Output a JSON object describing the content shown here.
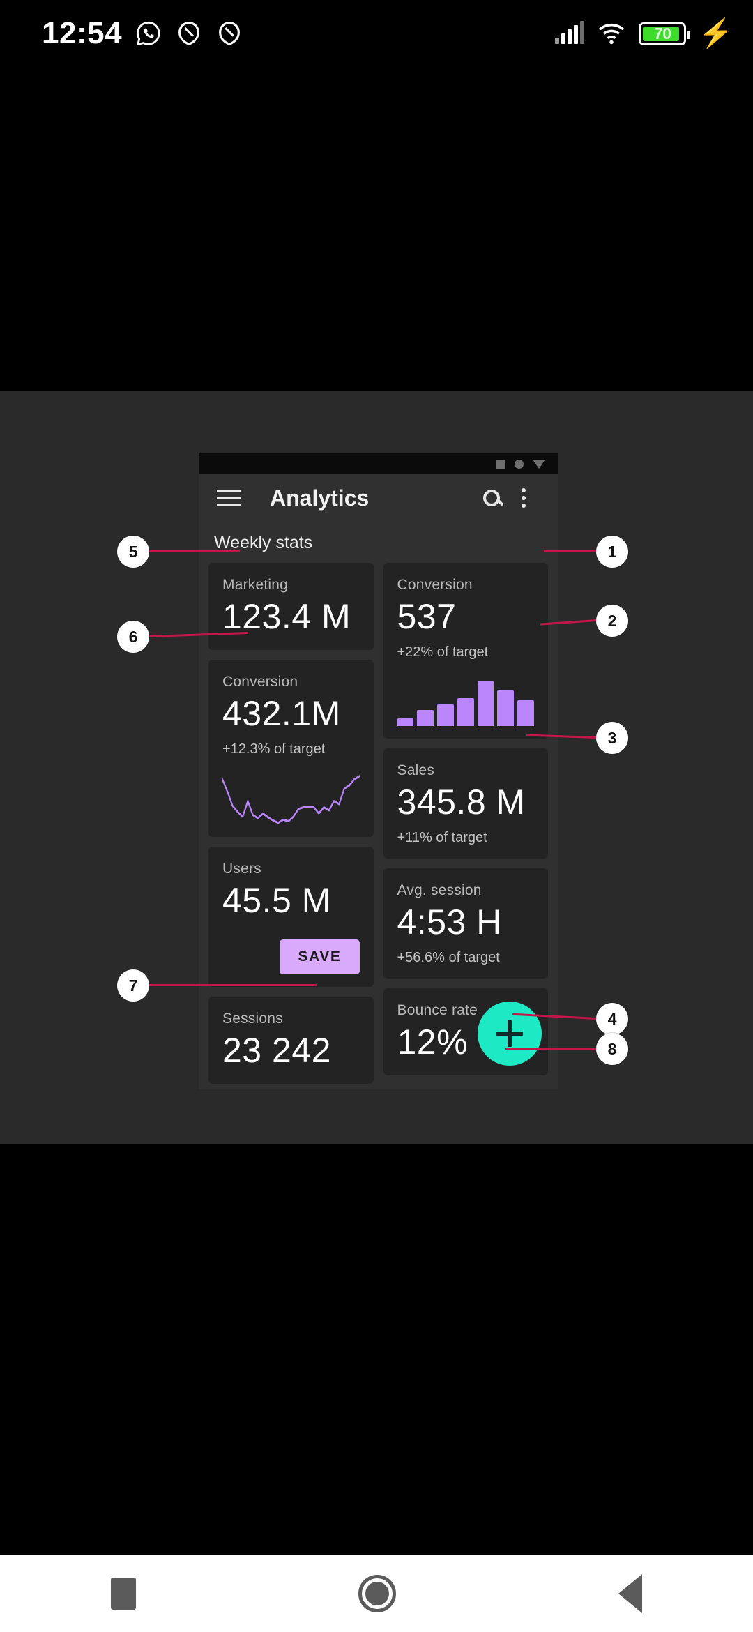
{
  "status_bar": {
    "clock": "12:54",
    "left_icons": [
      "whatsapp-icon",
      "dnd-icon",
      "dnd-icon"
    ],
    "signal_icon": "cellular-signal-icon",
    "wifi_icon": "wifi-icon",
    "battery_level": "70",
    "charging_icon": "lightning-bolt-icon"
  },
  "device_preview": {
    "mock_status_icons": [
      "square-icon",
      "circle-icon",
      "triangle-down-icon"
    ],
    "appbar": {
      "menu_icon": "hamburger-menu-icon",
      "title": "Analytics",
      "search_icon": "search-icon",
      "overflow_icon": "more-vertical-icon"
    },
    "section_title": "Weekly stats",
    "fab": {
      "icon": "plus-icon",
      "color": "#1de9c4"
    },
    "accent_purple": "#bb86fc",
    "left_column": [
      {
        "label": "Marketing",
        "value": "123.4 M",
        "sub": "",
        "chart": "none"
      },
      {
        "label": "Conversion",
        "value": "432.1M",
        "sub": "+12.3% of target",
        "chart": "line"
      },
      {
        "label": "Users",
        "value": "45.5 M",
        "sub": "",
        "chart": "none",
        "action_label": "SAVE"
      },
      {
        "label": "Sessions",
        "value": "23 242",
        "sub": "",
        "chart": "none"
      }
    ],
    "right_column": [
      {
        "label": "Conversion",
        "value": "537",
        "sub": "+22% of target",
        "chart": "bar"
      },
      {
        "label": "Sales",
        "value": "345.8 M",
        "sub": "+11% of target",
        "chart": "none"
      },
      {
        "label": "Avg. session",
        "value": "4:53 H",
        "sub": "+56.6% of target",
        "chart": "none"
      },
      {
        "label": "Bounce rate",
        "value": "12%",
        "sub": "",
        "chart": "none"
      }
    ]
  },
  "chart_data": [
    {
      "type": "bar",
      "title": "Conversion weekly bars",
      "categories": [
        "1",
        "2",
        "3",
        "4",
        "5",
        "6",
        "7"
      ],
      "values": [
        12,
        26,
        34,
        45,
        72,
        57,
        41
      ],
      "xlabel": "",
      "ylabel": "",
      "ylim": [
        0,
        80
      ],
      "color": "#bb86fc",
      "grid": false,
      "legend": "none"
    },
    {
      "type": "line",
      "title": "Conversion trend sparkline",
      "x": [
        0,
        1,
        2,
        3,
        4,
        5,
        6,
        7,
        8,
        9,
        10,
        11,
        12,
        13,
        14,
        15,
        16,
        17,
        18,
        19,
        20,
        21,
        22,
        23,
        24,
        25,
        26,
        27
      ],
      "values": [
        58,
        42,
        24,
        16,
        10,
        30,
        12,
        8,
        14,
        9,
        5,
        2,
        6,
        4,
        10,
        20,
        22,
        22,
        22,
        14,
        22,
        18,
        30,
        26,
        46,
        50,
        58,
        62
      ],
      "xlabel": "",
      "ylabel": "",
      "ylim": [
        0,
        70
      ],
      "color": "#bb86fc",
      "grid": false,
      "legend": "none"
    }
  ],
  "annotations": [
    {
      "number": "1"
    },
    {
      "number": "2"
    },
    {
      "number": "3"
    },
    {
      "number": "4"
    },
    {
      "number": "5"
    },
    {
      "number": "6"
    },
    {
      "number": "7"
    },
    {
      "number": "8"
    }
  ],
  "nav_bar": {
    "recents_icon": "square-recents-icon",
    "home_icon": "circle-home-icon",
    "back_icon": "triangle-back-icon"
  }
}
